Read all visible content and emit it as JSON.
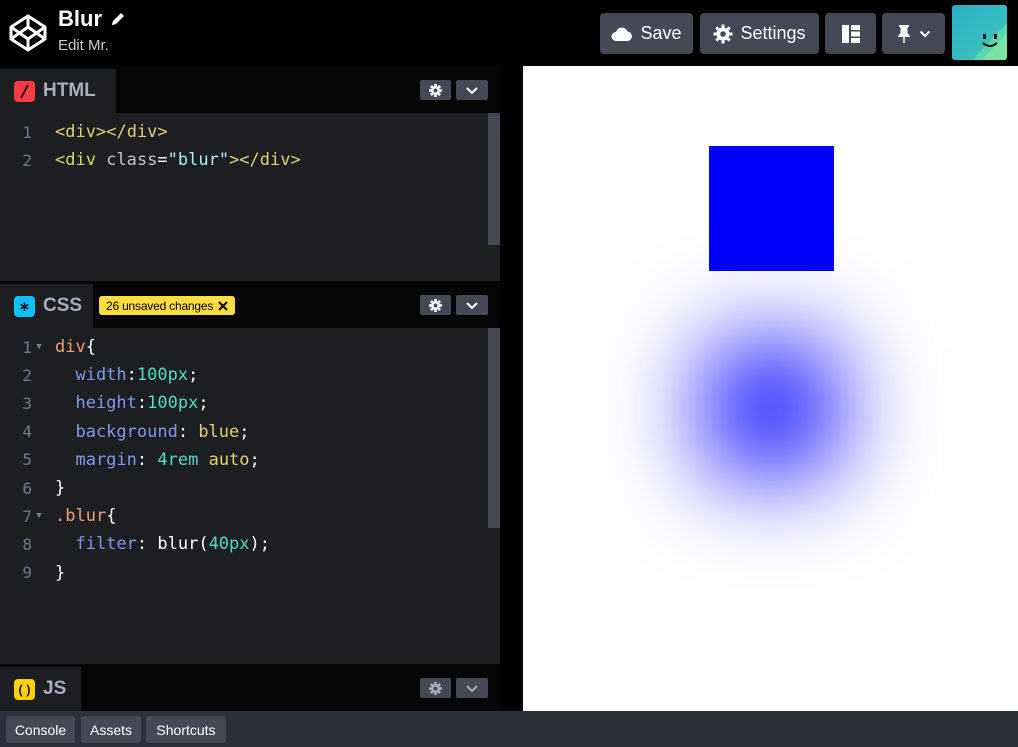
{
  "header": {
    "pen_title": "Blur",
    "subtitle": "Edit Mr.",
    "save_label": "Save",
    "settings_label": "Settings"
  },
  "html_panel": {
    "tab_label": "HTML",
    "lines": [
      {
        "num": "1",
        "tokens": [
          {
            "t": "<",
            "c": "c-tag"
          },
          {
            "t": "div",
            "c": "c-tag"
          },
          {
            "t": "></",
            "c": "c-tag"
          },
          {
            "t": "div",
            "c": "c-tag"
          },
          {
            "t": ">",
            "c": "c-tag"
          }
        ]
      },
      {
        "num": "2",
        "tokens": [
          {
            "t": "<",
            "c": "c-tag"
          },
          {
            "t": "div",
            "c": "c-tag"
          },
          {
            "t": " class",
            "c": "c-attr"
          },
          {
            "t": "=",
            "c": "c-p"
          },
          {
            "t": "\"blur\"",
            "c": "c-str"
          },
          {
            "t": "></",
            "c": "c-tag"
          },
          {
            "t": "div",
            "c": "c-tag"
          },
          {
            "t": ">",
            "c": "c-tag"
          }
        ]
      }
    ]
  },
  "css_panel": {
    "tab_label": "CSS",
    "unsaved_badge": "26 unsaved changes",
    "lines": [
      {
        "num": "1",
        "fold": "▼",
        "tokens": [
          {
            "t": "div",
            "c": "c-sel"
          },
          {
            "t": "{",
            "c": "c-p"
          }
        ]
      },
      {
        "num": "2",
        "tokens": [
          {
            "t": "  width",
            "c": "c-prop"
          },
          {
            "t": ":",
            "c": "c-p"
          },
          {
            "t": "100px",
            "c": "c-num"
          },
          {
            "t": ";",
            "c": "c-p"
          }
        ]
      },
      {
        "num": "3",
        "tokens": [
          {
            "t": "  height",
            "c": "c-prop"
          },
          {
            "t": ":",
            "c": "c-p"
          },
          {
            "t": "100px",
            "c": "c-num"
          },
          {
            "t": ";",
            "c": "c-p"
          }
        ]
      },
      {
        "num": "4",
        "tokens": [
          {
            "t": "  background",
            "c": "c-prop"
          },
          {
            "t": ": ",
            "c": "c-p"
          },
          {
            "t": "blue",
            "c": "c-val"
          },
          {
            "t": ";",
            "c": "c-p"
          }
        ]
      },
      {
        "num": "5",
        "tokens": [
          {
            "t": "  margin",
            "c": "c-prop"
          },
          {
            "t": ": ",
            "c": "c-p"
          },
          {
            "t": "4rem",
            "c": "c-num"
          },
          {
            "t": " ",
            "c": "c-p"
          },
          {
            "t": "auto",
            "c": "c-val"
          },
          {
            "t": ";",
            "c": "c-p"
          }
        ]
      },
      {
        "num": "6",
        "tokens": [
          {
            "t": "}",
            "c": "c-p"
          }
        ]
      },
      {
        "num": "7",
        "fold": "▼",
        "tokens": [
          {
            "t": ".blur",
            "c": "c-sel"
          },
          {
            "t": "{",
            "c": "c-p"
          }
        ]
      },
      {
        "num": "8",
        "tokens": [
          {
            "t": "  filter",
            "c": "c-prop"
          },
          {
            "t": ": ",
            "c": "c-p"
          },
          {
            "t": "blur(",
            "c": "c-p"
          },
          {
            "t": "40px",
            "c": "c-num"
          },
          {
            "t": ");",
            "c": "c-p"
          }
        ]
      },
      {
        "num": "9",
        "tokens": [
          {
            "t": "}",
            "c": "c-p"
          }
        ]
      }
    ]
  },
  "js_panel": {
    "tab_label": "JS"
  },
  "bottom_bar": {
    "console_label": "Console",
    "assets_label": "Assets",
    "shortcuts_label": "Shortcuts"
  },
  "colors": {
    "html_icon": "#ff3c41",
    "css_icon": "#0ebeff",
    "js_icon": "#fcd000",
    "badge": "#ffdd40",
    "preview_square": "#0000ff"
  }
}
